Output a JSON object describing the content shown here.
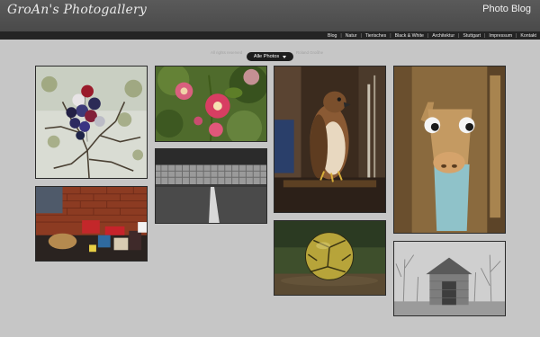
{
  "header": {
    "site_title": "GroAn's Photogallery",
    "blog_title": "Photo Blog"
  },
  "nav": {
    "items": [
      "Blog",
      "Natur",
      "Tierisches",
      "Black & White",
      "Architektur",
      "Stuttgart",
      "Impressum",
      "Kontakt"
    ]
  },
  "filter": {
    "left_text": "All rights reserved",
    "selected": "Alle Photos",
    "right_text": "Roland Großhe"
  },
  "photos": [
    {
      "subject": "balloons-tree"
    },
    {
      "subject": "gifts-brick-wall"
    },
    {
      "subject": "pink-hollyhock"
    },
    {
      "subject": "grill-fence-bw"
    },
    {
      "subject": "hawk"
    },
    {
      "subject": "soccer-ball"
    },
    {
      "subject": "wooden-figure"
    },
    {
      "subject": "stone-house-bw"
    }
  ]
}
